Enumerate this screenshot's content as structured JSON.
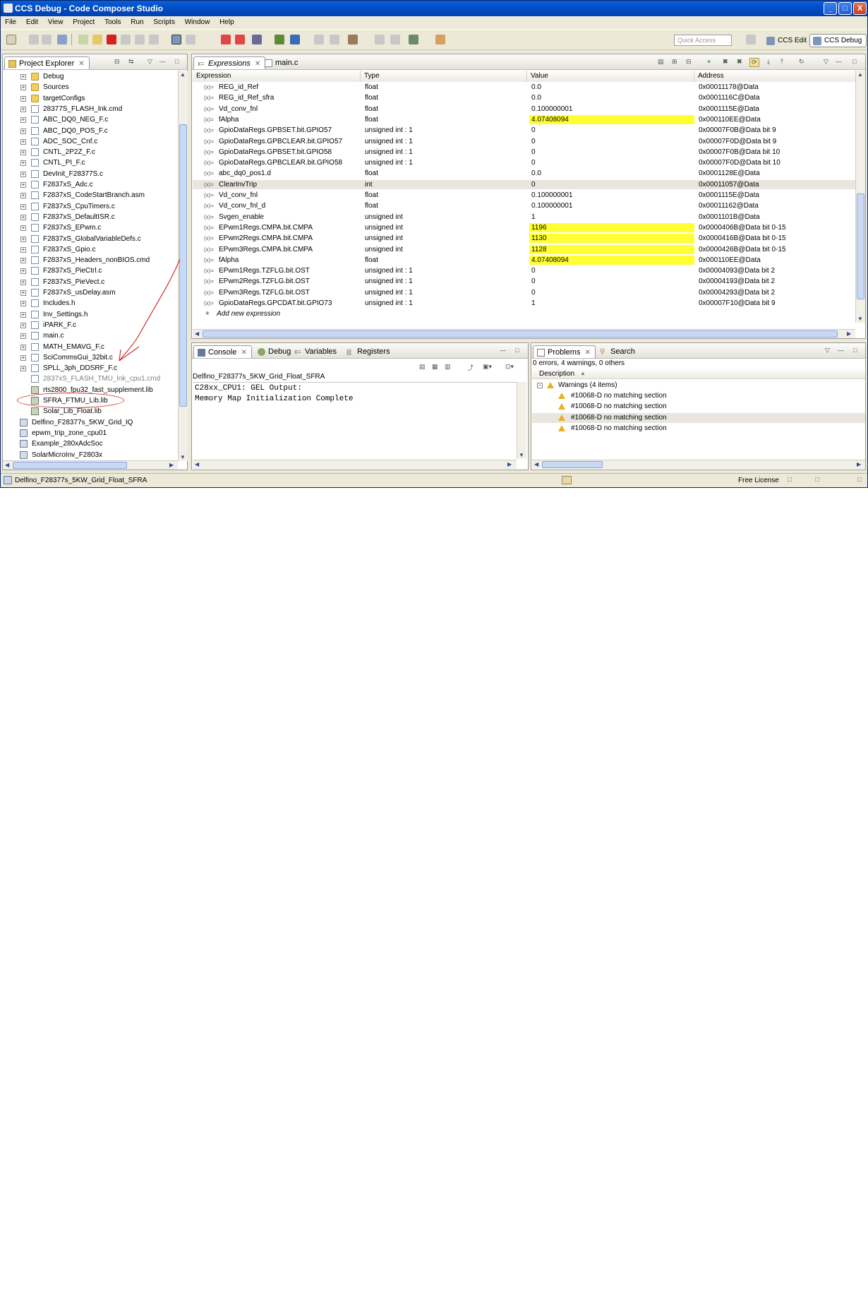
{
  "window": {
    "title": "CCS Debug - Code Composer Studio",
    "minimize": "_",
    "maximize": "□",
    "close": "X"
  },
  "menu": [
    "File",
    "Edit",
    "View",
    "Project",
    "Tools",
    "Run",
    "Scripts",
    "Window",
    "Help"
  ],
  "toolbar": {
    "quick_access_placeholder": "Quick Access",
    "perspectives": [
      {
        "label": "CCS Edit",
        "active": false
      },
      {
        "label": "CCS Debug",
        "active": true
      }
    ]
  },
  "project_explorer": {
    "title": "Project Explorer",
    "items": [
      {
        "label": "Debug",
        "kind": "folder",
        "expand": "+"
      },
      {
        "label": "Sources",
        "kind": "folder",
        "expand": "+"
      },
      {
        "label": "targetConfigs",
        "kind": "folder",
        "expand": "+"
      },
      {
        "label": "28377S_FLASH_lnk.cmd",
        "kind": "file",
        "expand": "+"
      },
      {
        "label": "ABC_DQ0_NEG_F.c",
        "kind": "file",
        "expand": "+"
      },
      {
        "label": "ABC_DQ0_POS_F.c",
        "kind": "file",
        "expand": "+"
      },
      {
        "label": "ADC_SOC_Cnf.c",
        "kind": "file",
        "expand": "+"
      },
      {
        "label": "CNTL_2P2Z_F.c",
        "kind": "file",
        "expand": "+"
      },
      {
        "label": "CNTL_PI_F.c",
        "kind": "file",
        "expand": "+"
      },
      {
        "label": "DevInit_F28377S.c",
        "kind": "file",
        "expand": "+"
      },
      {
        "label": "F2837xS_Adc.c",
        "kind": "file",
        "expand": "+"
      },
      {
        "label": "F2837xS_CodeStartBranch.asm",
        "kind": "file",
        "expand": "+"
      },
      {
        "label": "F2837xS_CpuTimers.c",
        "kind": "file",
        "expand": "+"
      },
      {
        "label": "F2837xS_DefaultISR.c",
        "kind": "file",
        "expand": "+"
      },
      {
        "label": "F2837xS_EPwm.c",
        "kind": "file",
        "expand": "+"
      },
      {
        "label": "F2837xS_GlobalVariableDefs.c",
        "kind": "file",
        "expand": "+"
      },
      {
        "label": "F2837xS_Gpio.c",
        "kind": "file",
        "expand": "+"
      },
      {
        "label": "F2837xS_Headers_nonBIOS.cmd",
        "kind": "file",
        "expand": "+"
      },
      {
        "label": "F2837xS_PieCtrl.c",
        "kind": "file",
        "expand": "+"
      },
      {
        "label": "F2837xS_PieVect.c",
        "kind": "file",
        "expand": "+"
      },
      {
        "label": "F2837xS_usDelay.asm",
        "kind": "file",
        "expand": "+"
      },
      {
        "label": "Includes.h",
        "kind": "file",
        "expand": "+"
      },
      {
        "label": "Inv_Settings.h",
        "kind": "file",
        "expand": "+"
      },
      {
        "label": "iPARK_F.c",
        "kind": "file",
        "expand": "+"
      },
      {
        "label": "main.c",
        "kind": "file",
        "expand": "+"
      },
      {
        "label": "MATH_EMAVG_F.c",
        "kind": "file",
        "expand": "+"
      },
      {
        "label": "SciCommsGui_32bit.c",
        "kind": "file",
        "expand": "+"
      },
      {
        "label": "SPLL_3ph_DDSRF_F.c",
        "kind": "file",
        "expand": "+"
      },
      {
        "label": "2837xS_FLASH_TMU_lnk_cpu1.cmd",
        "kind": "file",
        "expand": "",
        "dim": true
      },
      {
        "label": "rts2800_fpu32_fast_supplement.lib",
        "kind": "lib",
        "expand": ""
      },
      {
        "label": "SFRA_FTMU_Lib.lib",
        "kind": "lib",
        "expand": ""
      },
      {
        "label": "Solar_Lib_Float.lib",
        "kind": "lib",
        "expand": ""
      }
    ],
    "projects": [
      "Delfino_F28377s_5KW_Grid_IQ",
      "epwm_trip_zone_cpu01",
      "Example_280xAdcSoc",
      "SolarMicroInv_F2803x"
    ]
  },
  "editor_tabs": [
    {
      "label": "Expressions",
      "active": true
    },
    {
      "label": "main.c",
      "active": false
    }
  ],
  "expressions": {
    "headers": [
      "Expression",
      "Type",
      "Value",
      "Address"
    ],
    "rows": [
      {
        "expr": "REG_id_Ref",
        "type": "float",
        "value": "0.0",
        "addr": "0x00011178@Data",
        "hl": false
      },
      {
        "expr": "REG_id_Ref_sfra",
        "type": "float",
        "value": "0.0",
        "addr": "0x0001116C@Data",
        "hl": false
      },
      {
        "expr": "Vd_conv_fnl",
        "type": "float",
        "value": "0.100000001",
        "addr": "0x0001115E@Data",
        "hl": false
      },
      {
        "expr": "fAlpha",
        "type": "float",
        "value": "4.07408094",
        "addr": "0x000110EE@Data",
        "hl": true
      },
      {
        "expr": "GpioDataRegs.GPBSET.bit.GPIO57",
        "type": "unsigned int : 1",
        "value": "0",
        "addr": "0x00007F0B@Data bit 9",
        "hl": false
      },
      {
        "expr": "GpioDataRegs.GPBCLEAR.bit.GPIO57",
        "type": "unsigned int : 1",
        "value": "0",
        "addr": "0x00007F0D@Data bit 9",
        "hl": false
      },
      {
        "expr": "GpioDataRegs.GPBSET.bit.GPIO58",
        "type": "unsigned int : 1",
        "value": "0",
        "addr": "0x00007F0B@Data bit 10",
        "hl": false
      },
      {
        "expr": "GpioDataRegs.GPBCLEAR.bit.GPIO58",
        "type": "unsigned int : 1",
        "value": "0",
        "addr": "0x00007F0D@Data bit 10",
        "hl": false
      },
      {
        "expr": "abc_dq0_pos1.d",
        "type": "float",
        "value": "0.0",
        "addr": "0x0001128E@Data",
        "hl": false
      },
      {
        "expr": "ClearInvTrip",
        "type": "int",
        "value": "0",
        "addr": "0x00011057@Data",
        "hl": false,
        "sel": true
      },
      {
        "expr": "Vd_conv_fnl",
        "type": "float",
        "value": "0.100000001",
        "addr": "0x0001115E@Data",
        "hl": false
      },
      {
        "expr": "Vd_conv_fnl_d",
        "type": "float",
        "value": "0.100000001",
        "addr": "0x00011162@Data",
        "hl": false
      },
      {
        "expr": "Svgen_enable",
        "type": "unsigned int",
        "value": "1",
        "addr": "0x0001101B@Data",
        "hl": false
      },
      {
        "expr": "EPwm1Regs.CMPA.bit.CMPA",
        "type": "unsigned int",
        "value": "1196",
        "addr": "0x0000406B@Data bit 0-15",
        "hl": true
      },
      {
        "expr": "EPwm2Regs.CMPA.bit.CMPA",
        "type": "unsigned int",
        "value": "1130",
        "addr": "0x0000416B@Data bit 0-15",
        "hl": true
      },
      {
        "expr": "EPwm3Regs.CMPA.bit.CMPA",
        "type": "unsigned int",
        "value": "1128",
        "addr": "0x0000426B@Data bit 0-15",
        "hl": true
      },
      {
        "expr": "fAlpha",
        "type": "float",
        "value": "4.07408094",
        "addr": "0x000110EE@Data",
        "hl": true
      },
      {
        "expr": "EPwm1Regs.TZFLG.bit.OST",
        "type": "unsigned int : 1",
        "value": "0",
        "addr": "0x00004093@Data bit 2",
        "hl": false
      },
      {
        "expr": "EPwm2Regs.TZFLG.bit.OST",
        "type": "unsigned int : 1",
        "value": "0",
        "addr": "0x00004193@Data bit 2",
        "hl": false
      },
      {
        "expr": "EPwm3Regs.TZFLG.bit.OST",
        "type": "unsigned int : 1",
        "value": "0",
        "addr": "0x00004293@Data bit 2",
        "hl": false
      },
      {
        "expr": "GpioDataRegs.GPCDAT.bit.GPIO73",
        "type": "unsigned int : 1",
        "value": "1",
        "addr": "0x00007F10@Data bit 9",
        "hl": false
      }
    ],
    "add_new": "Add new expression"
  },
  "console": {
    "tabs": [
      "Console",
      "Debug",
      "Variables",
      "Registers"
    ],
    "session": "Delfino_F28377s_5KW_Grid_Float_SFRA",
    "lines": [
      "C28xx_CPU1: GEL Output:",
      "Memory Map Initialization Complete"
    ]
  },
  "problems": {
    "tabs": [
      "Problems",
      "Search"
    ],
    "summary": "0 errors, 4 warnings, 0 others",
    "column": "Description",
    "group": "Warnings (4 items)",
    "items": [
      "#10068-D no matching section",
      "#10068-D no matching section",
      "#10068-D no matching section",
      "#10068-D no matching section"
    ]
  },
  "status": {
    "selected": "Delfino_F28377s_5KW_Grid_Float_SFRA",
    "license": "Free License"
  },
  "colors": {
    "highlight": "#ffff33",
    "annotation": "#d23030",
    "titlebar": "#0050c8"
  }
}
